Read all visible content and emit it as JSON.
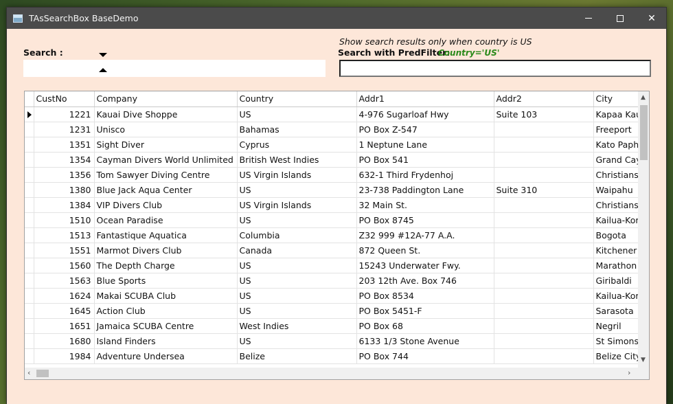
{
  "window": {
    "title": "TAsSearchBox BaseDemo"
  },
  "search": {
    "label": "Search :"
  },
  "predfilter": {
    "note": "Show search results only when country is US",
    "label": "Search with PredFilter:",
    "value": "Country='US'"
  },
  "grid": {
    "columns": [
      "CustNo",
      "Company",
      "Country",
      "Addr1",
      "Addr2",
      "City"
    ],
    "rows": [
      [
        "1221",
        "Kauai Dive Shoppe",
        "US",
        "4-976 Sugarloaf Hwy",
        "Suite 103",
        "Kapaa Kau"
      ],
      [
        "1231",
        "Unisco",
        "Bahamas",
        "PO Box Z-547",
        "",
        "Freeport"
      ],
      [
        "1351",
        "Sight Diver",
        "Cyprus",
        "1 Neptune Lane",
        "",
        "Kato Paph"
      ],
      [
        "1354",
        "Cayman Divers World Unlimited",
        "British West Indies",
        "PO Box 541",
        "",
        "Grand Cay"
      ],
      [
        "1356",
        "Tom Sawyer Diving Centre",
        "US Virgin Islands",
        "632-1 Third Frydenhoj",
        "",
        "Christianst"
      ],
      [
        "1380",
        "Blue Jack Aqua Center",
        "US",
        "23-738 Paddington Lane",
        "Suite 310",
        "Waipahu"
      ],
      [
        "1384",
        "VIP Divers Club",
        "US Virgin Islands",
        "32 Main St.",
        "",
        "Christianst"
      ],
      [
        "1510",
        "Ocean Paradise",
        "US",
        "PO Box 8745",
        "",
        "Kailua-Kor"
      ],
      [
        "1513",
        "Fantastique Aquatica",
        "Columbia",
        "Z32 999 #12A-77 A.A.",
        "",
        "Bogota"
      ],
      [
        "1551",
        "Marmot Divers Club",
        "Canada",
        "872 Queen St.",
        "",
        "Kitchener"
      ],
      [
        "1560",
        "The Depth Charge",
        "US",
        "15243 Underwater Fwy.",
        "",
        "Marathon"
      ],
      [
        "1563",
        "Blue Sports",
        "US",
        "203 12th Ave. Box 746",
        "",
        "Giribaldi"
      ],
      [
        "1624",
        "Makai SCUBA Club",
        "US",
        "PO Box 8534",
        "",
        "Kailua-Kor"
      ],
      [
        "1645",
        "Action Club",
        "US",
        "PO Box 5451-F",
        "",
        "Sarasota"
      ],
      [
        "1651",
        "Jamaica SCUBA Centre",
        "West Indies",
        "PO Box 68",
        "",
        "Negril"
      ],
      [
        "1680",
        "Island Finders",
        "US",
        "6133 1/3 Stone Avenue",
        "",
        "St Simons"
      ],
      [
        "1984",
        "Adventure Undersea",
        "Belize",
        "PO Box 744",
        "",
        "Belize City"
      ]
    ]
  }
}
